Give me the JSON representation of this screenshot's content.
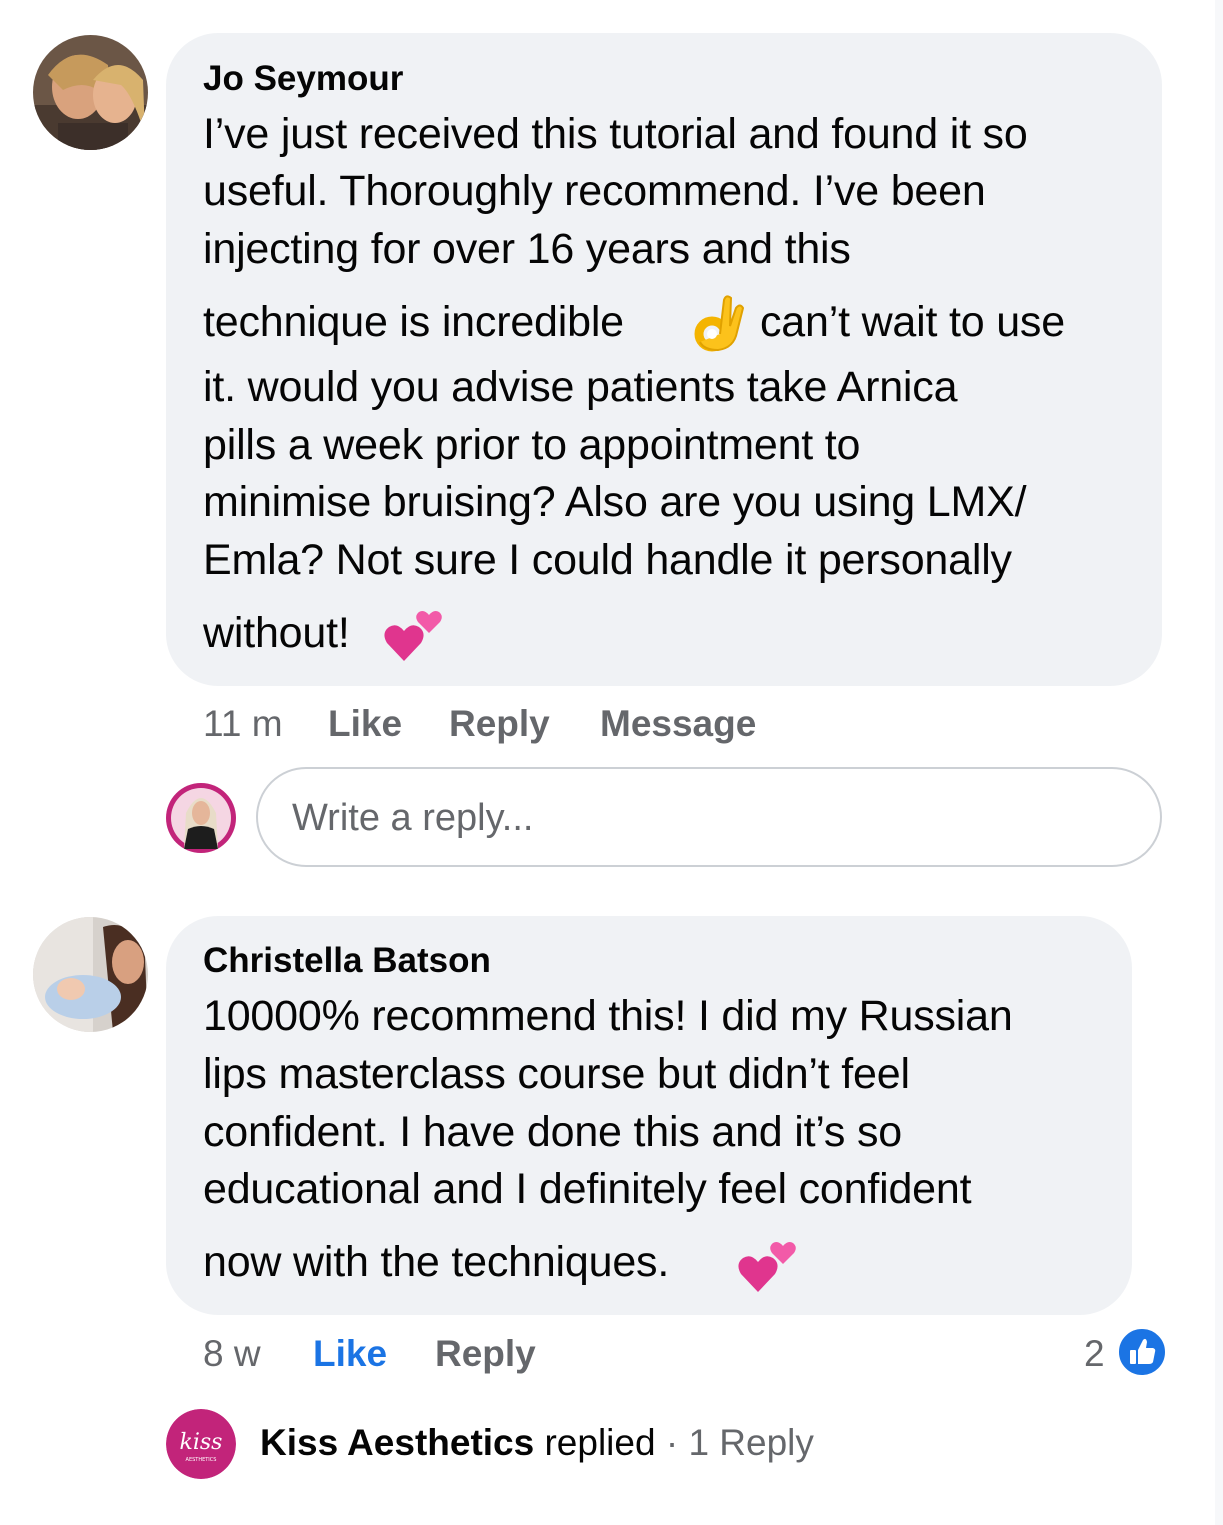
{
  "comments": [
    {
      "author": "Jo Seymour",
      "lines": [
        "I’ve just received this tutorial and found it so",
        "useful.  Thoroughly recommend. I’ve been",
        "injecting for over 16 years and this",
        "technique is incredible",
        "can’t wait to use",
        "it. would you advise patients take Arnica",
        "pills a week prior to appointment to",
        "minimise bruising? Also are you using LMX/",
        "Emla? Not sure I could handle it personally",
        "without!"
      ],
      "emojis": [
        "ok-hand-emoji",
        "two-hearts-emoji"
      ],
      "time": "11 m",
      "actions": {
        "like": "Like",
        "reply": "Reply",
        "message": "Message"
      }
    },
    {
      "author": "Christella Batson",
      "lines": [
        "10000% recommend this! I did my Russian",
        "lips masterclass course but didn’t feel",
        "confident. I have done this and it’s so",
        "educational and I definitely feel confident",
        "now with the techniques."
      ],
      "emojis": [
        "two-hearts-emoji"
      ],
      "time": "8 w",
      "actions": {
        "like": "Like",
        "reply": "Reply"
      },
      "reaction_count": "2",
      "liked": true
    }
  ],
  "reply_box": {
    "placeholder": "Write a reply..."
  },
  "replied": {
    "name": "Kiss Aesthetics",
    "text": "replied",
    "separator": "·",
    "count": "1 Reply",
    "logo_text": "kiss",
    "logo_subtext": "AESTHETICS"
  },
  "colors": {
    "bubble": "#f0f2f5",
    "meta": "#65676b",
    "like_blue": "#1b74e4",
    "kiss_pink": "#c2247a"
  }
}
